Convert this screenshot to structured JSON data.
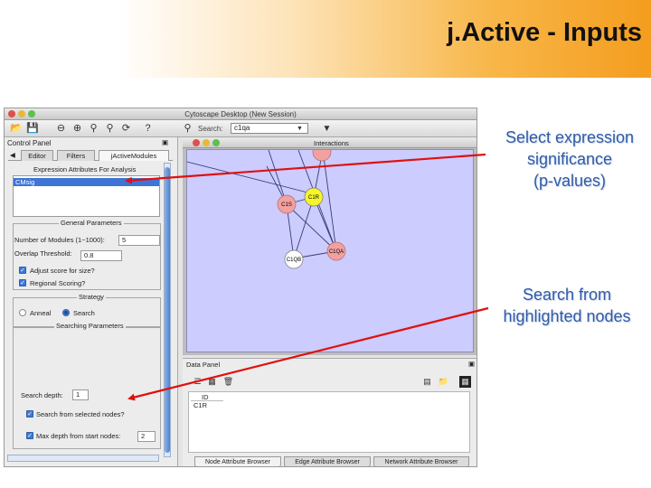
{
  "slide": {
    "title": "j.Active - Inputs"
  },
  "window": {
    "title": "Cytoscape Desktop (New Session)"
  },
  "toolbar": {
    "icons": [
      "open-icon",
      "save-icon",
      "zoom-out-icon",
      "zoom-in-icon",
      "zoom-selected-icon",
      "zoom-fit-icon",
      "refresh-icon",
      "help-icon"
    ],
    "search_label": "Search:",
    "search_value": "c1qa"
  },
  "control_panel": {
    "title": "Control Panel",
    "tabs": [
      "Editor",
      "Filters",
      "jActiveModules"
    ],
    "expression_header": "Expression Attributes For Analysis",
    "expression_selected": "CMsig",
    "general_header": "General Parameters",
    "num_modules_label": "Number of Modules (1~1000):",
    "num_modules_value": "5",
    "overlap_label": "Overlap Threshold:",
    "overlap_value": "0.8",
    "adjust_label": "Adjust score for size?",
    "regional_label": "Regional Scoring?",
    "strategy_header": "Strategy",
    "anneal_label": "Anneal",
    "search_label": "Search",
    "searching_header": "Searching Parameters",
    "search_depth_label": "Search depth:",
    "search_depth_value": "1",
    "from_selected_label": "Search from selected nodes?",
    "max_depth_label": "Max depth from start nodes:",
    "max_depth_value": "2"
  },
  "network": {
    "title": "Interactions",
    "nodes": [
      {
        "label": "C1R",
        "color": "#f5f52a"
      },
      {
        "label": "C1S",
        "color": "#f2a0a0"
      },
      {
        "label": "C1QA",
        "color": "#f2a0a0"
      },
      {
        "label": "C1QB",
        "color": "#ffffff"
      },
      {
        "label": "",
        "color": "#f2a0a0"
      }
    ]
  },
  "data_panel": {
    "title": "Data Panel",
    "column_header": "ID",
    "row_value": "C1R",
    "tabs": [
      "Node Attribute Browser",
      "Edge Attribute Browser",
      "Network Attribute Browser"
    ]
  },
  "annotations": {
    "callout1": [
      "Select expression",
      "significance",
      "(p-values)"
    ],
    "callout2": [
      "Search from",
      "highlighted nodes"
    ],
    "arrow_color": "#e01010"
  }
}
